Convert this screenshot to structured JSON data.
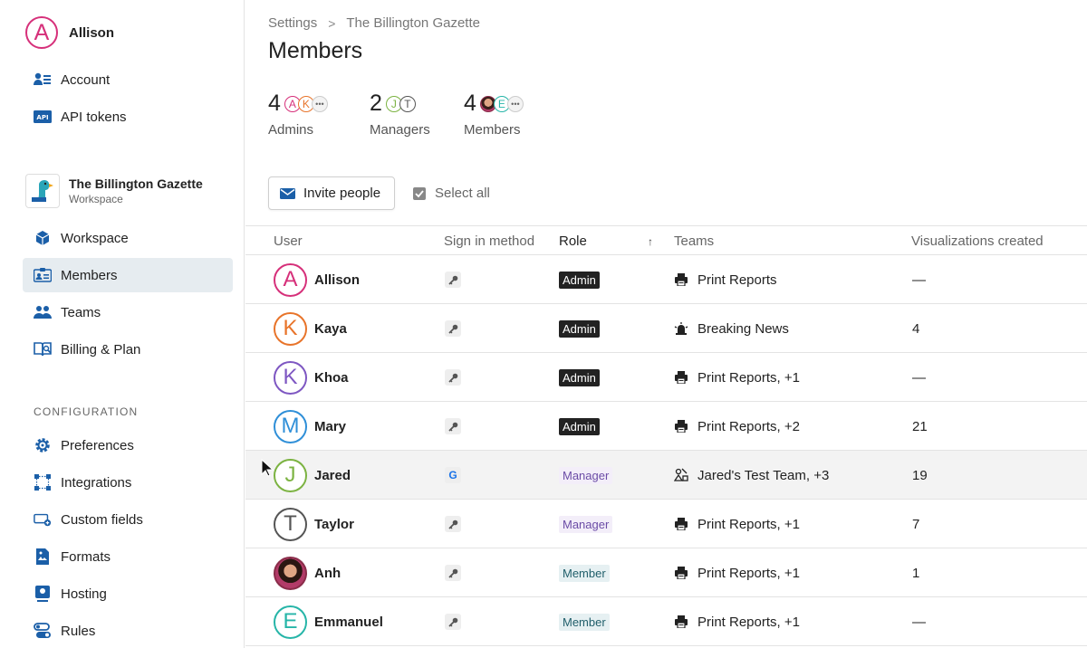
{
  "sidebar": {
    "user": {
      "initial": "A",
      "name": "Allison",
      "color": "#d6307a"
    },
    "top_items": [
      {
        "label": "Account",
        "icon": "account-icon"
      },
      {
        "label": "API tokens",
        "icon": "api-icon"
      }
    ],
    "workspace": {
      "name": "The Billington Gazette",
      "sub": "Workspace"
    },
    "workspace_items": [
      {
        "label": "Workspace",
        "icon": "cube-icon"
      },
      {
        "label": "Members",
        "icon": "id-card-icon",
        "active": true
      },
      {
        "label": "Teams",
        "icon": "teams-icon"
      },
      {
        "label": "Billing & Plan",
        "icon": "book-icon"
      }
    ],
    "config_label": "CONFIGURATION",
    "config_items": [
      {
        "label": "Preferences",
        "icon": "gear-icon"
      },
      {
        "label": "Integrations",
        "icon": "integrations-icon"
      },
      {
        "label": "Custom fields",
        "icon": "custom-fields-icon"
      },
      {
        "label": "Formats",
        "icon": "formats-icon"
      },
      {
        "label": "Hosting",
        "icon": "hosting-icon"
      },
      {
        "label": "Rules",
        "icon": "rules-icon"
      }
    ]
  },
  "breadcrumb": {
    "root": "Settings",
    "current": "The Billington Gazette"
  },
  "page_title": "Members",
  "stats": [
    {
      "count": "4",
      "label": "Admins"
    },
    {
      "count": "2",
      "label": "Managers"
    },
    {
      "count": "4",
      "label": "Members"
    }
  ],
  "stat_avatars": {
    "admins": [
      {
        "initial": "A",
        "color": "#d6307a"
      },
      {
        "initial": "K",
        "color": "#e8742a"
      }
    ],
    "managers": [
      {
        "initial": "J",
        "color": "#7cb342"
      },
      {
        "initial": "T",
        "color": "#555555"
      }
    ],
    "members": [
      {
        "initial": "",
        "color": "#8a2d4a"
      },
      {
        "initial": "E",
        "color": "#26b5a8"
      }
    ]
  },
  "toolbar": {
    "invite_label": "Invite people",
    "select_all_label": "Select all"
  },
  "table": {
    "headers": {
      "user": "User",
      "signin": "Sign in method",
      "role": "Role",
      "teams": "Teams",
      "viz": "Visualizations created"
    },
    "rows": [
      {
        "initial": "A",
        "color": "#d6307a",
        "name": "Allison",
        "signin": "key",
        "role": "Admin",
        "team_icon": "printer",
        "teams": "Print Reports",
        "viz": "—"
      },
      {
        "initial": "K",
        "color": "#e8742a",
        "name": "Kaya",
        "signin": "key",
        "role": "Admin",
        "team_icon": "siren",
        "teams": "Breaking News",
        "viz": "4"
      },
      {
        "initial": "K",
        "color": "#7e57c2",
        "name": "Khoa",
        "signin": "key",
        "role": "Admin",
        "team_icon": "printer",
        "teams": "Print Reports, +1",
        "viz": "—"
      },
      {
        "initial": "M",
        "color": "#2f8fd8",
        "name": "Mary",
        "signin": "key",
        "role": "Admin",
        "team_icon": "printer",
        "teams": "Print Reports, +2",
        "viz": "21"
      },
      {
        "initial": "J",
        "color": "#7cb342",
        "name": "Jared",
        "signin": "google",
        "role": "Manager",
        "team_icon": "shapes",
        "teams": "Jared's Test Team, +3",
        "viz": "19",
        "hover": true
      },
      {
        "initial": "T",
        "color": "#555555",
        "name": "Taylor",
        "signin": "key",
        "role": "Manager",
        "team_icon": "printer",
        "teams": "Print Reports, +1",
        "viz": "7"
      },
      {
        "initial": "",
        "color": "#8a2d4a",
        "name": "Anh",
        "signin": "key",
        "role": "Member",
        "team_icon": "printer",
        "teams": "Print Reports, +1",
        "viz": "1",
        "photo": true
      },
      {
        "initial": "E",
        "color": "#26b5a8",
        "name": "Emmanuel",
        "signin": "key",
        "role": "Member",
        "team_icon": "printer",
        "teams": "Print Reports, +1",
        "viz": "—"
      }
    ]
  }
}
